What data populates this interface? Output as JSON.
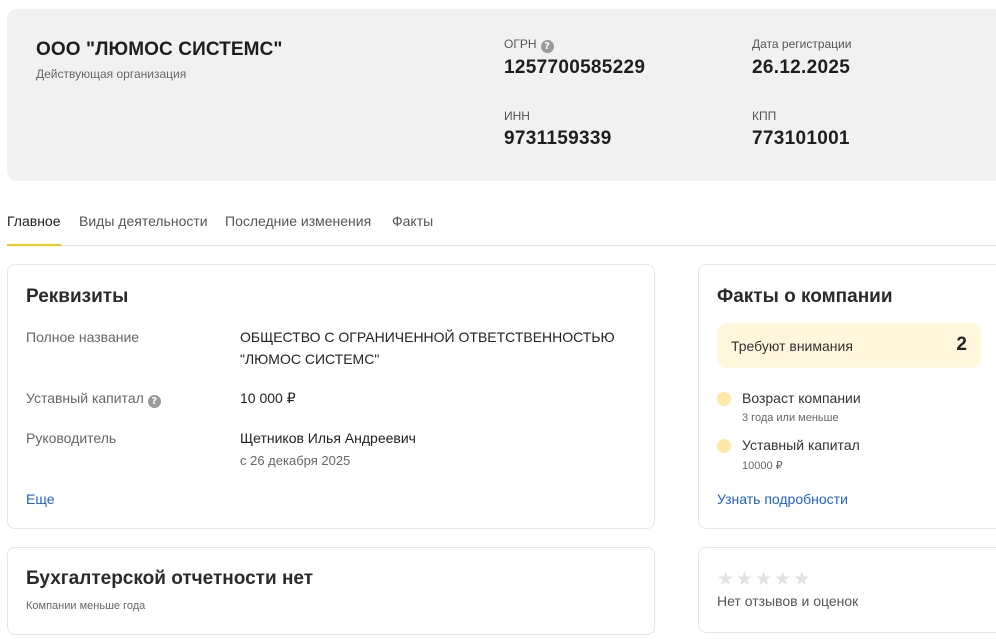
{
  "company": {
    "name": "ООО \"ЛЮМОС СИСТЕМС\"",
    "status": "Действующая организация",
    "ogrn_label": "ОГРН",
    "ogrn": "1257700585229",
    "reg_date_label": "Дата регистрации",
    "reg_date": "26.12.2025",
    "inn_label": "ИНН",
    "inn": "9731159339",
    "kpp_label": "КПП",
    "kpp": "773101001"
  },
  "tabs": [
    {
      "label": "Главное",
      "active": true
    },
    {
      "label": "Виды деятельности",
      "active": false
    },
    {
      "label": "Последние изменения",
      "active": false
    },
    {
      "label": "Факты",
      "active": false
    }
  ],
  "requisites": {
    "title": "Реквизиты",
    "full_name_label": "Полное название",
    "full_name_line1": "ОБЩЕСТВО С ОГРАНИЧЕННОЙ ОТВЕТСТВЕННОСТЬЮ",
    "full_name_line2": "\"ЛЮМОС СИСТЕМС\"",
    "capital_label": "Уставный капитал",
    "capital_value": "10 000 ₽",
    "director_label": "Руководитель",
    "director_name": "Щетников Илья Андреевич",
    "director_since": "с 26 декабря 2025",
    "more_link": "Еще"
  },
  "facts": {
    "title": "Факты о компании",
    "attention_label": "Требуют внимания",
    "attention_count": "2",
    "items": [
      {
        "title": "Возраст компании",
        "sub": "3 года или меньше"
      },
      {
        "title": "Уставный капитал",
        "sub": "10000 ₽"
      }
    ],
    "details_link": "Узнать подробности"
  },
  "accounting": {
    "title": "Бухгалтерской отчетности нет",
    "sub": "Компании меньше года"
  },
  "reviews": {
    "rating_stars": 0,
    "rating_max": 5,
    "text": "Нет отзывов и оценок"
  },
  "colors": {
    "accent": "#f5c518",
    "link": "#1a63c7",
    "header_bg": "#f1f1f1",
    "attention_bg": "#fff6dc",
    "fact_dot": "#fde8a8"
  }
}
